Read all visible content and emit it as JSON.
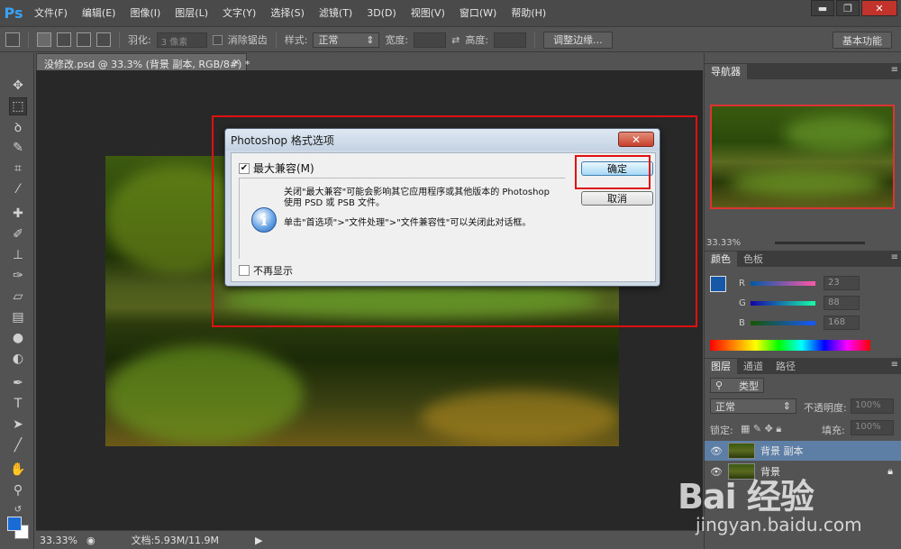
{
  "app": {
    "logo": "Ps",
    "menu": [
      "文件(F)",
      "编辑(E)",
      "图像(I)",
      "图层(L)",
      "文字(Y)",
      "选择(S)",
      "滤镜(T)",
      "3D(D)",
      "视图(V)",
      "窗口(W)",
      "帮助(H)"
    ],
    "window_controls": [
      "▬",
      "❐",
      "✕"
    ]
  },
  "options": {
    "feather_label": "羽化:",
    "feather_value": "3 像素",
    "antialias_label": "消除锯齿",
    "style_label": "样式:",
    "style_value": "正常",
    "width_label": "宽度:",
    "height_label": "高度:",
    "refine_button": "调整边缘...",
    "workspace_button": "基本功能"
  },
  "document": {
    "tab_title": "没修改.psd @ 33.3% (背景 副本, RGB/8#) *",
    "close_glyph": "×"
  },
  "status": {
    "zoom": "33.33%",
    "doc_size": "文档:5.93M/11.9M"
  },
  "panels": {
    "navigator_tab": "导航器",
    "navigator_zoom": "33.33%",
    "color_tabs": [
      "颜色",
      "色板"
    ],
    "color_channels": [
      {
        "label": "R",
        "value": "23"
      },
      {
        "label": "G",
        "value": "88"
      },
      {
        "label": "B",
        "value": "168"
      }
    ],
    "foreground_color": "#1758a8",
    "layers_tabs": [
      "图层",
      "通道",
      "路径"
    ],
    "layer_kind": "类型",
    "blend_mode": "正常",
    "opacity_label": "不透明度:",
    "opacity_value": "100%",
    "lock_label": "锁定:",
    "fill_label": "填充:",
    "fill_value": "100%",
    "layers": [
      {
        "name": "背景 副本",
        "selected": true
      },
      {
        "name": "背景",
        "selected": false
      }
    ]
  },
  "dialog": {
    "title": "Photoshop 格式选项",
    "max_compat_label": "最大兼容(M)",
    "max_compat_checked": true,
    "message_line1": "关闭\"最大兼容\"可能会影响其它应用程序或其他版本的 Photoshop",
    "message_line2": "使用 PSD 或 PSB 文件。",
    "message_line3": "单击\"首选项\">\"文件处理\">\"文件兼容性\"可以关闭此对话框。",
    "dont_show_label": "不再显示",
    "ok_button": "确定",
    "cancel_button": "取消",
    "close_glyph": "✕"
  },
  "watermark": {
    "brand": "Bai 经验",
    "url": "jingyan.baidu.com"
  },
  "colors": {
    "highlight_red": "#e01010",
    "ui_dark": "#535353",
    "canvas_bg": "#282828"
  }
}
